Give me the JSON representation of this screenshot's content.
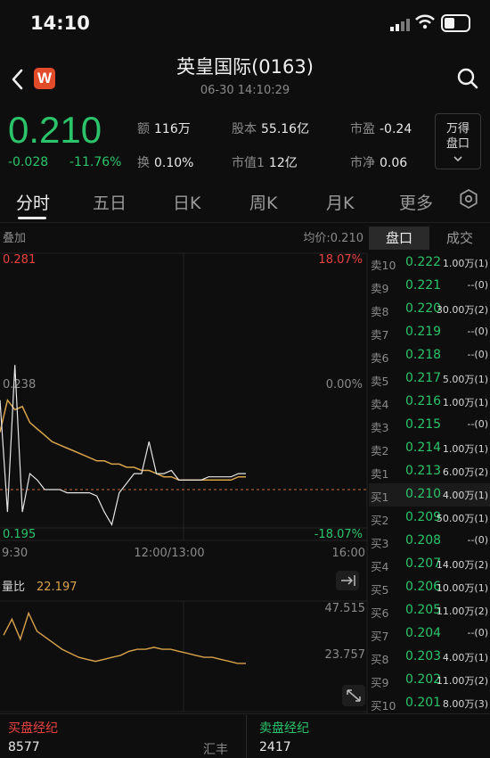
{
  "status_bar": {
    "time": "14:10"
  },
  "header": {
    "title": "英皇国际(0163)",
    "datetime": "06-30  14:10:29",
    "logo_letter": "W"
  },
  "quote": {
    "price": "0.210",
    "change": "-0.028",
    "change_pct": "-11.76%",
    "stats": [
      {
        "label": "额",
        "value": "116万"
      },
      {
        "label": "股本",
        "value": "55.16亿"
      },
      {
        "label": "市盈",
        "value": "-0.24"
      },
      {
        "label": "换",
        "value": "0.10%"
      },
      {
        "label": "市值1",
        "value": "12亿"
      },
      {
        "label": "市净",
        "value": "0.06"
      }
    ],
    "wande_line1": "万得",
    "wande_line2": "盘口"
  },
  "tabs": [
    "分时",
    "五日",
    "日K",
    "周K",
    "月K",
    "更多"
  ],
  "chart": {
    "overlay_label": "叠加",
    "avg_label": "均价:0.210",
    "price_high": "0.281",
    "price_mid": "0.238",
    "price_low": "0.195",
    "pct_high": "18.07%",
    "pct_mid": "0.00%",
    "pct_low": "-18.07%",
    "time_start": "9:30",
    "time_mid": "12:00/13:00",
    "time_end": "16:00",
    "vol_ratio_label": "量比",
    "vol_ratio_value": "22.197",
    "vol_high": "47.515",
    "vol_mid": "23.757"
  },
  "chart_data": {
    "type": "line",
    "series": [
      {
        "values": [
          0.225,
          0.235,
          0.232,
          0.233,
          0.228,
          0.226,
          0.224,
          0.222,
          0.221,
          0.22,
          0.219,
          0.218,
          0.217,
          0.216,
          0.216,
          0.215,
          0.215,
          0.214,
          0.214,
          0.213,
          0.213,
          0.212,
          0.211,
          0.211,
          0.21,
          0.21,
          0.21,
          0.21,
          0.21,
          0.21,
          0.21,
          0.21,
          0.211,
          0.211
        ]
      },
      {
        "values": [
          0.235,
          0.2,
          0.246,
          0.2,
          0.212,
          0.21,
          0.207,
          0.207,
          0.207,
          0.206,
          0.206,
          0.206,
          0.206,
          0.205,
          0.2,
          0.196,
          0.206,
          0.209,
          0.212,
          0.212,
          0.222,
          0.212,
          0.212,
          0.213,
          0.21,
          0.21,
          0.21,
          0.21,
          0.211,
          0.211,
          0.211,
          0.211,
          0.212,
          0.212
        ]
      },
      {
        "values": [
          38,
          46,
          36,
          49,
          40,
          37,
          34,
          31,
          29,
          27,
          26,
          25,
          26,
          27,
          28,
          30,
          31,
          31,
          32,
          31,
          31,
          30,
          29,
          28,
          27,
          27,
          26,
          25,
          24,
          24
        ]
      }
    ],
    "ylim": [
      0.195,
      0.281
    ]
  },
  "order_book": {
    "tab_active": "盘口",
    "tab_inactive": "成交",
    "sells": [
      {
        "label": "卖10",
        "price": "0.222",
        "vol": "1.00万(1)"
      },
      {
        "label": "卖9",
        "price": "0.221",
        "vol": "--(0)"
      },
      {
        "label": "卖8",
        "price": "0.220",
        "vol": "30.00万(2)"
      },
      {
        "label": "卖7",
        "price": "0.219",
        "vol": "--(0)"
      },
      {
        "label": "卖6",
        "price": "0.218",
        "vol": "--(0)"
      },
      {
        "label": "卖5",
        "price": "0.217",
        "vol": "5.00万(1)"
      },
      {
        "label": "卖4",
        "price": "0.216",
        "vol": "1.00万(1)"
      },
      {
        "label": "卖3",
        "price": "0.215",
        "vol": "--(0)"
      },
      {
        "label": "卖2",
        "price": "0.214",
        "vol": "1.00万(1)"
      },
      {
        "label": "卖1",
        "price": "0.213",
        "vol": "6.00万(2)"
      }
    ],
    "buys": [
      {
        "label": "买1",
        "price": "0.210",
        "vol": "4.00万(1)"
      },
      {
        "label": "买2",
        "price": "0.209",
        "vol": "50.00万(1)"
      },
      {
        "label": "买3",
        "price": "0.208",
        "vol": "--(0)"
      },
      {
        "label": "买4",
        "price": "0.207",
        "vol": "14.00万(2)"
      },
      {
        "label": "买5",
        "price": "0.206",
        "vol": "10.00万(1)"
      },
      {
        "label": "买6",
        "price": "0.205",
        "vol": "11.00万(2)"
      },
      {
        "label": "买7",
        "price": "0.204",
        "vol": "--(0)"
      },
      {
        "label": "买8",
        "price": "0.203",
        "vol": "4.00万(1)"
      },
      {
        "label": "买9",
        "price": "0.202",
        "vol": "11.00万(2)"
      },
      {
        "label": "买10",
        "price": "0.201",
        "vol": "8.00万(3)"
      }
    ]
  },
  "brokers": {
    "buy_title": "买盘经纪",
    "sell_title": "卖盘经纪",
    "buy_count": "8577",
    "buy_broker_name": "汇丰",
    "sell_count": "2417"
  },
  "colors": {
    "up": "#e8423f",
    "down": "#2cc46a",
    "avg_line": "#d9a34a",
    "price_line": "#e6e6e6"
  }
}
